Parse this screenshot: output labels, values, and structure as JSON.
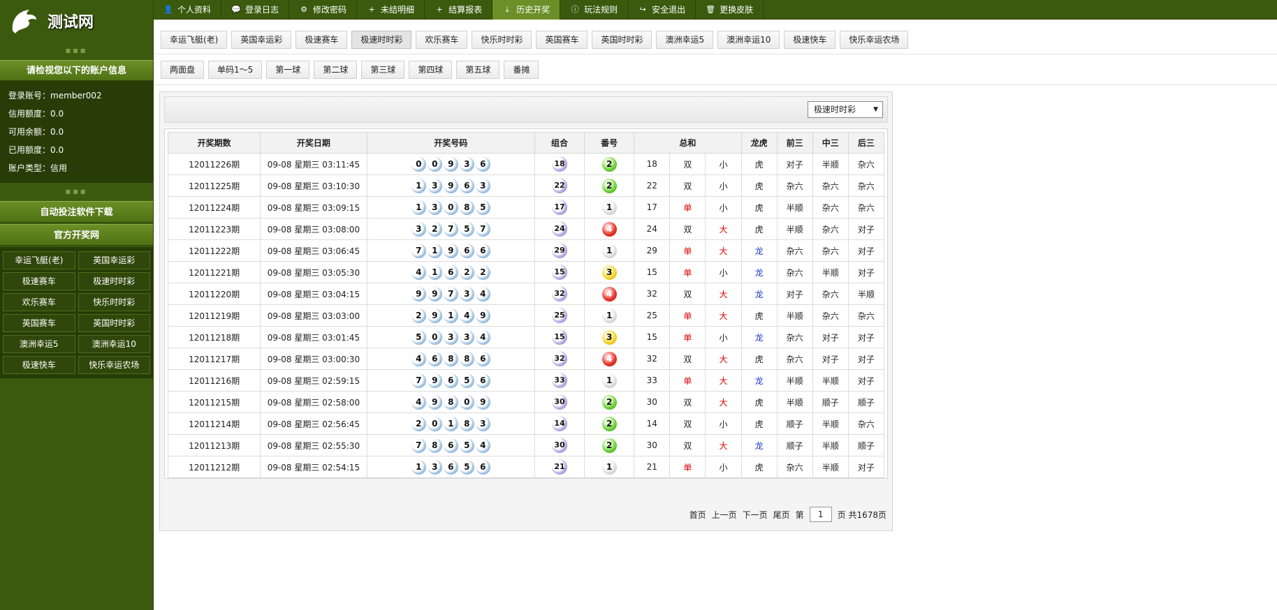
{
  "site": {
    "name": "测试网"
  },
  "sidebar": {
    "account_header": "请检视您以下的账户信息",
    "account": [
      {
        "label": "登录账号：",
        "value": "member002"
      },
      {
        "label": "信用额度：",
        "value": "0.0"
      },
      {
        "label": "可用余额：",
        "value": "0.0"
      },
      {
        "label": "已用额度：",
        "value": "0.0"
      },
      {
        "label": "账户类型：",
        "value": "信用"
      }
    ],
    "download_label": "自动投注软件下载",
    "official_label": "官方开奖网",
    "games": [
      "幸运飞艇(老)",
      "英国幸运彩",
      "极速赛车",
      "极速时时彩",
      "欢乐赛车",
      "快乐时时彩",
      "英国赛车",
      "英国时时彩",
      "澳洲幸运5",
      "澳洲幸运10",
      "极速快车",
      "快乐幸运农场"
    ]
  },
  "topnav": [
    {
      "icon": "user-icon",
      "glyph": "👤",
      "label": "个人资料"
    },
    {
      "icon": "comment-icon",
      "glyph": "💬",
      "label": "登录日志"
    },
    {
      "icon": "gear-icon",
      "glyph": "⚙",
      "label": "修改密码"
    },
    {
      "icon": "plus-icon",
      "glyph": "+",
      "label": "未结明细"
    },
    {
      "icon": "plus-icon",
      "glyph": "+",
      "label": "结算报表"
    },
    {
      "icon": "download-icon",
      "glyph": "⤓",
      "label": "历史开奖",
      "active": true
    },
    {
      "icon": "info-icon",
      "glyph": "ⓘ",
      "label": "玩法规则"
    },
    {
      "icon": "share-icon",
      "glyph": "↪",
      "label": "安全退出"
    },
    {
      "icon": "trash-icon",
      "glyph": "🗑",
      "label": "更换皮肤"
    }
  ],
  "game_tabs": [
    "幸运飞艇(老)",
    "英国幸运彩",
    "极速赛车",
    "极速时时彩",
    "欢乐赛车",
    "快乐时时彩",
    "英国赛车",
    "英国时时彩",
    "澳洲幸运5",
    "澳洲幸运10",
    "极速快车",
    "快乐幸运农场"
  ],
  "game_tab_active": 3,
  "sub_tabs": [
    "两面盘",
    "单码1～5",
    "第一球",
    "第二球",
    "第三球",
    "第四球",
    "第五球",
    "番摊"
  ],
  "select": {
    "value": "极速时时彩"
  },
  "table": {
    "headers": [
      "开奖期数",
      "开奖日期",
      "开奖号码",
      "组合",
      "番号",
      "总和",
      "龙虎",
      "前三",
      "中三",
      "后三"
    ],
    "rows": [
      {
        "period": "12011226期",
        "date": "09-08 星期三 03:11:45",
        "balls": [
          "0",
          "0",
          "9",
          "3",
          "6"
        ],
        "combo": "18",
        "fan": "2",
        "fan_color": "green",
        "sum": "18",
        "oe": "双",
        "bs": "小",
        "dt": "虎",
        "q3": "对子",
        "z3": "半顺",
        "h3": "杂六"
      },
      {
        "period": "12011225期",
        "date": "09-08 星期三 03:10:30",
        "balls": [
          "1",
          "3",
          "9",
          "6",
          "3"
        ],
        "combo": "22",
        "fan": "2",
        "fan_color": "green",
        "sum": "22",
        "oe": "双",
        "bs": "小",
        "dt": "虎",
        "q3": "杂六",
        "z3": "杂六",
        "h3": "杂六"
      },
      {
        "period": "12011224期",
        "date": "09-08 星期三 03:09:15",
        "balls": [
          "1",
          "3",
          "0",
          "8",
          "5"
        ],
        "combo": "17",
        "fan": "1",
        "fan_color": "grey",
        "sum": "17",
        "oe": "单",
        "bs": "小",
        "dt": "虎",
        "q3": "半顺",
        "z3": "杂六",
        "h3": "杂六"
      },
      {
        "period": "12011223期",
        "date": "09-08 星期三 03:08:00",
        "balls": [
          "3",
          "2",
          "7",
          "5",
          "7"
        ],
        "combo": "24",
        "fan": "4",
        "fan_color": "red",
        "sum": "24",
        "oe": "双",
        "bs": "大",
        "dt": "虎",
        "q3": "半顺",
        "z3": "杂六",
        "h3": "对子"
      },
      {
        "period": "12011222期",
        "date": "09-08 星期三 03:06:45",
        "balls": [
          "7",
          "1",
          "9",
          "6",
          "6"
        ],
        "combo": "29",
        "fan": "1",
        "fan_color": "grey",
        "sum": "29",
        "oe": "单",
        "bs": "大",
        "dt": "龙",
        "q3": "杂六",
        "z3": "杂六",
        "h3": "对子"
      },
      {
        "period": "12011221期",
        "date": "09-08 星期三 03:05:30",
        "balls": [
          "4",
          "1",
          "6",
          "2",
          "2"
        ],
        "combo": "15",
        "fan": "3",
        "fan_color": "yellow",
        "sum": "15",
        "oe": "单",
        "bs": "小",
        "dt": "龙",
        "q3": "杂六",
        "z3": "半顺",
        "h3": "对子"
      },
      {
        "period": "12011220期",
        "date": "09-08 星期三 03:04:15",
        "balls": [
          "9",
          "9",
          "7",
          "3",
          "4"
        ],
        "combo": "32",
        "fan": "4",
        "fan_color": "red",
        "sum": "32",
        "oe": "双",
        "bs": "大",
        "dt": "龙",
        "q3": "对子",
        "z3": "杂六",
        "h3": "半顺"
      },
      {
        "period": "12011219期",
        "date": "09-08 星期三 03:03:00",
        "balls": [
          "2",
          "9",
          "1",
          "4",
          "9"
        ],
        "combo": "25",
        "fan": "1",
        "fan_color": "grey",
        "sum": "25",
        "oe": "单",
        "bs": "大",
        "dt": "虎",
        "q3": "半顺",
        "z3": "杂六",
        "h3": "杂六"
      },
      {
        "period": "12011218期",
        "date": "09-08 星期三 03:01:45",
        "balls": [
          "5",
          "0",
          "3",
          "3",
          "4"
        ],
        "combo": "15",
        "fan": "3",
        "fan_color": "yellow",
        "sum": "15",
        "oe": "单",
        "bs": "小",
        "dt": "龙",
        "q3": "杂六",
        "z3": "对子",
        "h3": "对子"
      },
      {
        "period": "12011217期",
        "date": "09-08 星期三 03:00:30",
        "balls": [
          "4",
          "6",
          "8",
          "8",
          "6"
        ],
        "combo": "32",
        "fan": "4",
        "fan_color": "red",
        "sum": "32",
        "oe": "双",
        "bs": "大",
        "dt": "虎",
        "q3": "杂六",
        "z3": "对子",
        "h3": "对子"
      },
      {
        "period": "12011216期",
        "date": "09-08 星期三 02:59:15",
        "balls": [
          "7",
          "9",
          "6",
          "5",
          "6"
        ],
        "combo": "33",
        "fan": "1",
        "fan_color": "grey",
        "sum": "33",
        "oe": "单",
        "bs": "大",
        "dt": "龙",
        "q3": "半顺",
        "z3": "半顺",
        "h3": "对子"
      },
      {
        "period": "12011215期",
        "date": "09-08 星期三 02:58:00",
        "balls": [
          "4",
          "9",
          "8",
          "0",
          "9"
        ],
        "combo": "30",
        "fan": "2",
        "fan_color": "green",
        "sum": "30",
        "oe": "双",
        "bs": "大",
        "dt": "虎",
        "q3": "半顺",
        "z3": "顺子",
        "h3": "顺子"
      },
      {
        "period": "12011214期",
        "date": "09-08 星期三 02:56:45",
        "balls": [
          "2",
          "0",
          "1",
          "8",
          "3"
        ],
        "combo": "14",
        "fan": "2",
        "fan_color": "green",
        "sum": "14",
        "oe": "双",
        "bs": "小",
        "dt": "虎",
        "q3": "顺子",
        "z3": "半顺",
        "h3": "杂六"
      },
      {
        "period": "12011213期",
        "date": "09-08 星期三 02:55:30",
        "balls": [
          "7",
          "8",
          "6",
          "5",
          "4"
        ],
        "combo": "30",
        "fan": "2",
        "fan_color": "green",
        "sum": "30",
        "oe": "双",
        "bs": "大",
        "dt": "龙",
        "q3": "顺子",
        "z3": "半顺",
        "h3": "顺子"
      },
      {
        "period": "12011212期",
        "date": "09-08 星期三 02:54:15",
        "balls": [
          "1",
          "3",
          "6",
          "5",
          "6"
        ],
        "combo": "21",
        "fan": "1",
        "fan_color": "grey",
        "sum": "21",
        "oe": "单",
        "bs": "小",
        "dt": "虎",
        "q3": "杂六",
        "z3": "半顺",
        "h3": "对子"
      }
    ]
  },
  "pager": {
    "first": "首页",
    "prev": "上一页",
    "next": "下一页",
    "last": "尾页",
    "page_prefix": "第",
    "page": "1",
    "page_suffix": "页 共1678页"
  }
}
